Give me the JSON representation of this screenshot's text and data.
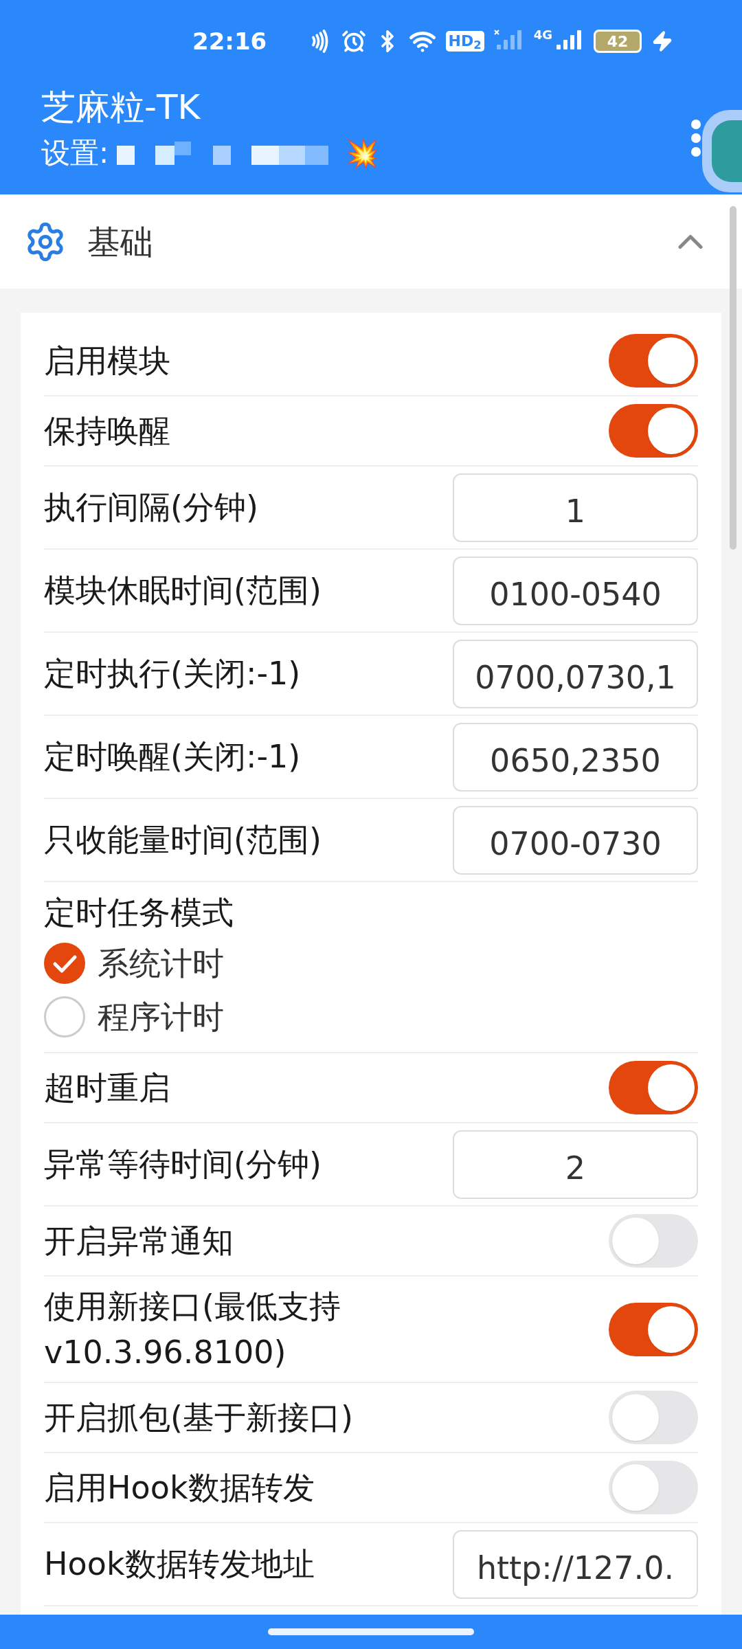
{
  "status_bar": {
    "time": "22:16",
    "hd_badge": "HD$_{2}$",
    "network_type": "4G",
    "battery": "42"
  },
  "app_bar": {
    "title": "芝麻粒-TK",
    "subtitle": "设置:",
    "subtitle_emoji": "💥"
  },
  "section": {
    "title": "基础",
    "expanded": true
  },
  "rows": [
    {
      "kind": "toggle",
      "label": "启用模块",
      "on": true
    },
    {
      "kind": "toggle",
      "label": "保持唤醒",
      "on": true
    },
    {
      "kind": "input",
      "label": "执行间隔(分钟)",
      "value": "1"
    },
    {
      "kind": "input",
      "label": "模块休眠时间(范围)",
      "value": "0100-0540"
    },
    {
      "kind": "input",
      "label": "定时执行(关闭:-1)",
      "value": "0700,0730,1"
    },
    {
      "kind": "input",
      "label": "定时唤醒(关闭:-1)",
      "value": "0650,2350"
    },
    {
      "kind": "input",
      "label": "只收能量时间(范围)",
      "value": "0700-0730"
    },
    {
      "kind": "radio_group",
      "label": "定时任务模式",
      "options": [
        {
          "label": "系统计时",
          "selected": true
        },
        {
          "label": "程序计时",
          "selected": false
        }
      ]
    },
    {
      "kind": "toggle",
      "label": "超时重启",
      "on": true
    },
    {
      "kind": "input",
      "label": "异常等待时间(分钟)",
      "value": "2"
    },
    {
      "kind": "toggle",
      "label": "开启异常通知",
      "on": false
    },
    {
      "kind": "toggle",
      "label": "使用新接口(最低支持v10.3.96.8100)",
      "on": true
    },
    {
      "kind": "toggle",
      "label": "开启抓包(基于新接口)",
      "on": false
    },
    {
      "kind": "toggle",
      "label": "启用Hook数据转发",
      "on": false
    },
    {
      "kind": "input",
      "label": "Hook数据转发地址",
      "value": "http://127.0."
    }
  ]
}
